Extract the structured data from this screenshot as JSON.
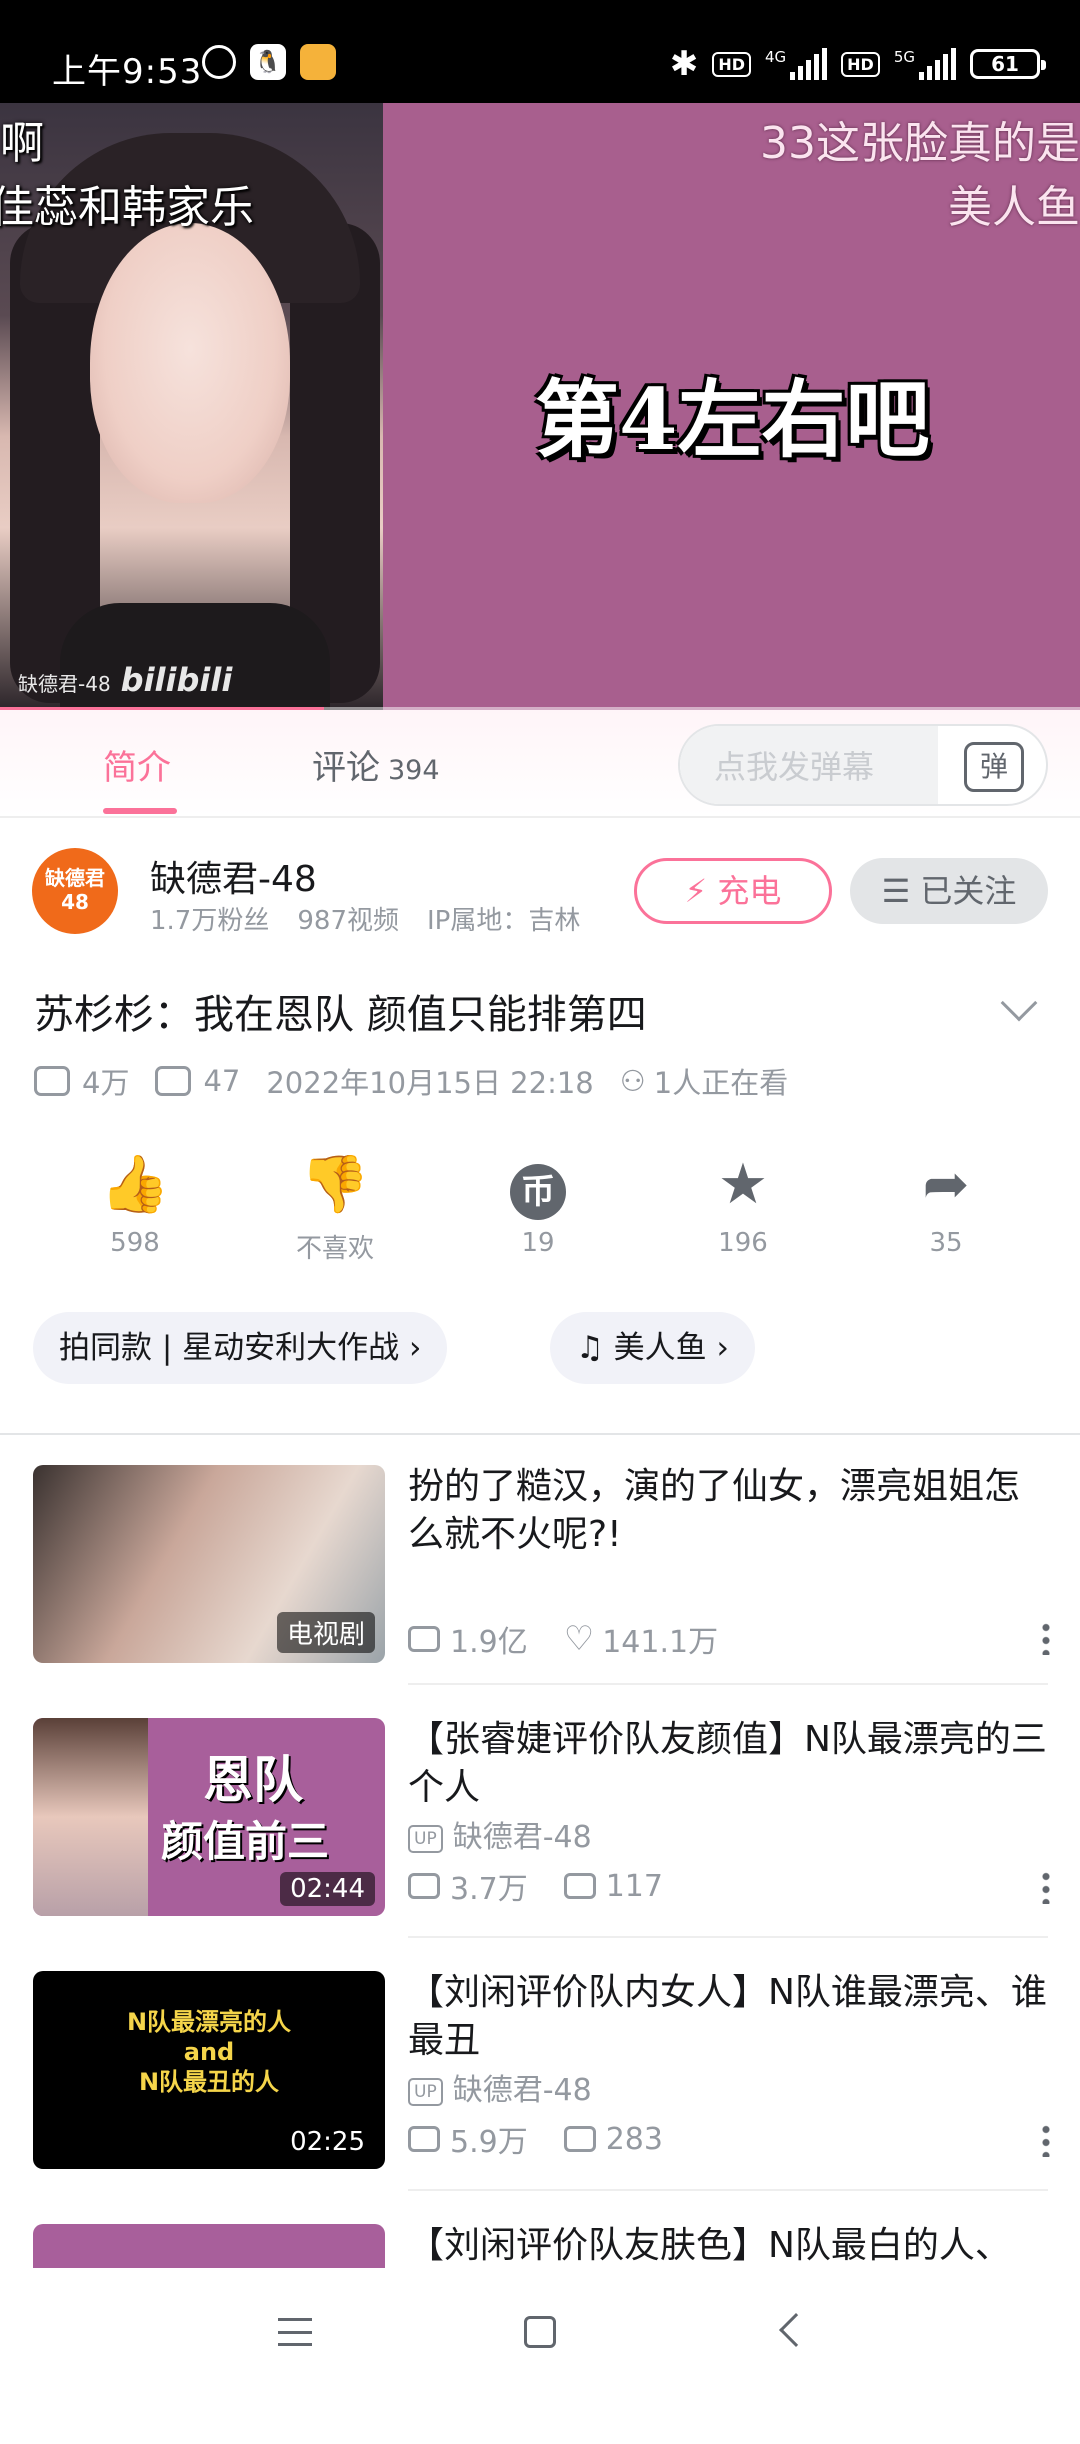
{
  "status": {
    "time": "上午9:53",
    "hd1": "HD",
    "net1": "4G",
    "hd2": "HD",
    "net2": "5G",
    "battery": "61"
  },
  "player": {
    "overlay_left_1": "啊",
    "overlay_left_2": "佳蕊和韩家乐",
    "overlay_right_1": "33这张脸真的是",
    "overlay_right_2": "美人鱼",
    "caption": "第4左右吧",
    "watermark": "缺德君-48",
    "watermark_logo": "bilibili",
    "progress": 0.3
  },
  "tabs": [
    {
      "label": "简介"
    },
    {
      "label": "评论",
      "count": "394"
    }
  ],
  "danmaku": {
    "placeholder": "点我发弹幕",
    "button": "弹"
  },
  "uploader": {
    "avatar_text": "缺德君 48",
    "name": "缺德君-48",
    "fans": "1.7万粉丝",
    "videos": "987视频",
    "ip": "IP属地：吉林",
    "charge": "⚡ 充电",
    "follow": "☰ 已关注"
  },
  "video": {
    "title": "苏杉杉：我在恩队 颜值只能排第四",
    "views": "4万",
    "danmaku_count": "47",
    "date": "2022年10月15日 22:18",
    "watching": "1人正在看"
  },
  "actions": [
    {
      "icon": "👍",
      "label": "598"
    },
    {
      "icon": "👎",
      "label": "不喜欢"
    },
    {
      "icon": "币",
      "label": "19"
    },
    {
      "icon": "★",
      "label": "196"
    },
    {
      "icon": "➦",
      "label": "35"
    }
  ],
  "tags": [
    {
      "text": "拍同款 | 星动安利大作战 ›"
    },
    {
      "text": "♫ 美人鱼 ›"
    }
  ],
  "related": [
    {
      "title": "扮的了糙汉，演的了仙女，漂亮姐姐怎么就不火呢?!",
      "badge": "电视剧",
      "views": "1.9亿",
      "likes": "141.1万"
    },
    {
      "title": "【张睿婕评价队友颜值】N队最漂亮的三个人",
      "thumb_text_1": "恩队",
      "thumb_text_2": "颜值前三",
      "duration": "02:44",
      "up": "缺德君-48",
      "views": "3.7万",
      "danmaku": "117"
    },
    {
      "title": "【刘闲评价队内女人】N队谁最漂亮、谁最丑",
      "thumb_text_1": "N队最漂亮的人",
      "thumb_text_2": "and",
      "thumb_text_3": "N队最丑的人",
      "duration": "02:25",
      "up": "缺德君-48",
      "views": "5.9万",
      "danmaku": "283"
    },
    {
      "title": "【刘闲评价队友肤色】N队最白的人、"
    }
  ],
  "up_tag": "UP"
}
